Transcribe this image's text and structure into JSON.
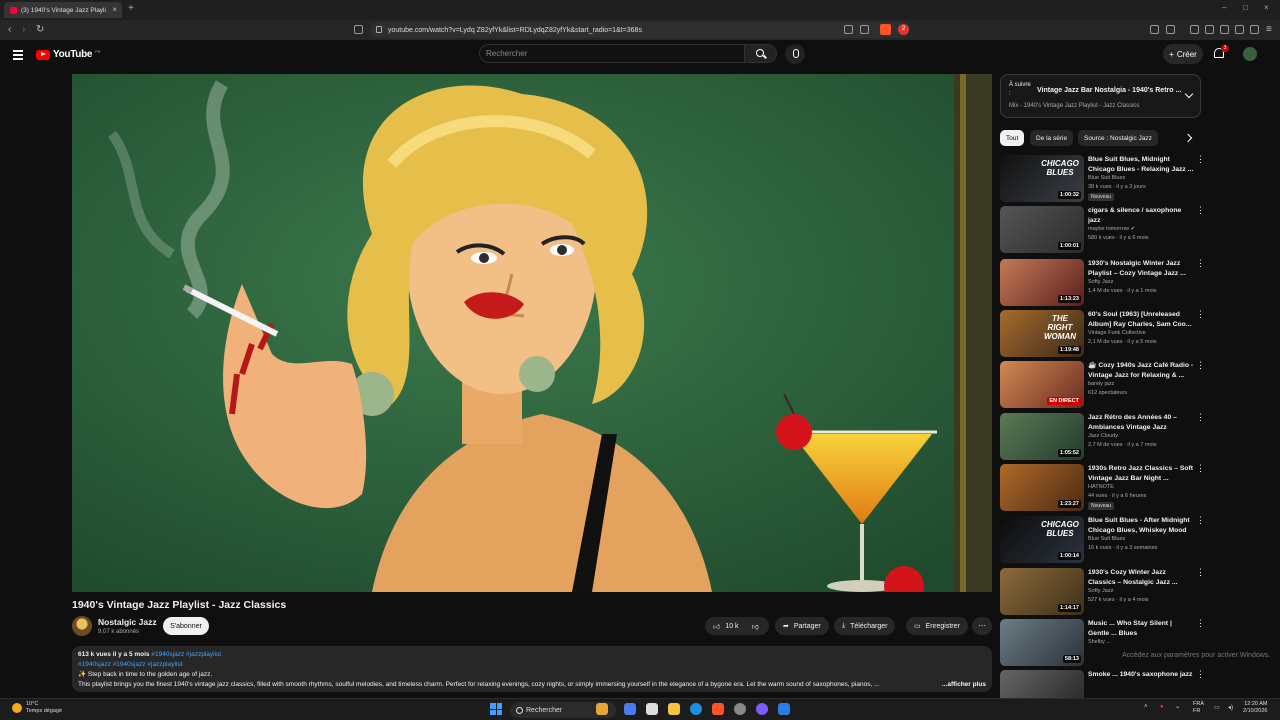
{
  "browser": {
    "tab_title": "(3) 1940's Vintage Jazz Playli",
    "url": "youtube.com/watch?v=Lydq Z82yfYk&list=RDLydqZ82yfYk&start_radio=1&t=368s",
    "ext_badge": "2"
  },
  "header": {
    "logo_text": "YouTube",
    "logo_country": "FR",
    "search_placeholder": "Rechercher",
    "create_label": "Créer",
    "notification_count": "3"
  },
  "video": {
    "title": "1940's Vintage Jazz Playlist - Jazz Classics",
    "channel_name": "Nostalgic Jazz",
    "channel_subs": "9,07 k abonnés",
    "subscribe_label": "S'abonner",
    "like_count": "10 k",
    "share_label": "Partager",
    "download_label": "Télécharger",
    "save_label": "Enregistrer"
  },
  "description": {
    "stats": "613 k vues  il y a 5 mois",
    "tags_line1": "#1940sjazz #jazzplaylist",
    "tags_line2": "#1940sjazz #1940sjazz #jazzplaylist",
    "line3": "✨ Step back in time to the golden age of jazz.",
    "line4": "This playlist brings you the finest 1940's vintage jazz classics, filled with smooth rhythms, soulful melodies, and timeless charm. Perfect for relaxing evenings, cozy nights, or simply immersing yourself in the elegance of a bygone era. Let the warm sound of saxophones, pianos, ...",
    "more_label": "...afficher plus"
  },
  "mix": {
    "label": "À suivre :",
    "title": "Vintage Jazz Bar Nostalgia - 1940's Retro ...",
    "subtitle": "Mix - 1940's Vintage Jazz Playlist - Jazz Classics"
  },
  "chips": [
    "Tout",
    "De la série",
    "Source : Nostalgic Jazz"
  ],
  "recommendations": [
    {
      "title": "Blue Suit Blues, Midnight Chicago Blues - Relaxing Jazz ...",
      "channel": "Blue Suit Blues",
      "meta": "38 k vues · il y a 3 jours",
      "duration": "1:00:32",
      "badge": "Nouveau",
      "thumb_text": "CHICAGO BLUES"
    },
    {
      "title": "cigars & silence / saxophone jazz",
      "channel": "maybe tomorrow ✔",
      "meta": "580 k vues · il y a 6 mois",
      "duration": "1:00:01",
      "badge": "",
      "thumb_text": ""
    },
    {
      "title": "1930's Nostalgic Winter Jazz Playlist – Cozy Vintage Jazz ...",
      "channel": "Softy Jazz",
      "meta": "1,4 M de vues · il y a 1 mois",
      "duration": "1:13:23",
      "badge": "",
      "thumb_text": ""
    },
    {
      "title": "60's Soul (1963) [Unreleased Album] Ray Charles, Sam Coo...",
      "channel": "Vintage Funk Collective",
      "meta": "2,1 M de vues · il y a 5 mois",
      "duration": "1:19:48",
      "badge": "",
      "thumb_text": "THE RIGHT WOMAN"
    },
    {
      "title": "☕ Cozy 1940s Jazz Café Radio - Vintage Jazz for Relaxing & ...",
      "channel": "barely jazz",
      "meta": "612 spectateurs",
      "duration": "EN DIRECT",
      "badge": "",
      "thumb_text": ""
    },
    {
      "title": "Jazz Rétro des Années 40 – Ambiances Vintage Jazz",
      "channel": "Jazz Cloudy",
      "meta": "2,7 M de vues · il y a 7 mois",
      "duration": "1:05:52",
      "badge": "",
      "thumb_text": ""
    },
    {
      "title": "1930s Retro Jazz Classics – Soft Vintage Jazz Bar Night ...",
      "channel": "HATNOTE",
      "meta": "44 vues · il y a 6 heures",
      "duration": "1:23:27",
      "badge": "Nouveau",
      "thumb_text": ""
    },
    {
      "title": "Blue Suit Blues - After Midnight Chicago Blues, Whiskey Mood",
      "channel": "Blue Suit Blues",
      "meta": "16 k vues · il y a 3 semaines",
      "duration": "1:00:14",
      "badge": "",
      "thumb_text": "CHICAGO BLUES"
    },
    {
      "title": "1930's Cozy Winter Jazz Classics – Nostalgic Jazz ...",
      "channel": "Softy Jazz",
      "meta": "527 k vues · il y a 4 mois",
      "duration": "1:14:17",
      "badge": "",
      "thumb_text": ""
    },
    {
      "title": "Music ... Who Stay Silent | Gentle ... Blues",
      "channel": "Shelby ...",
      "meta": "",
      "duration": "58:13",
      "badge": "",
      "thumb_text": ""
    },
    {
      "title": "Smoke ... 1940's saxophone jazz",
      "channel": "",
      "meta": "",
      "duration": "",
      "badge": "",
      "thumb_text": ""
    }
  ],
  "watermark": "Accédez aux paramètres pour activer Windows.",
  "taskbar": {
    "temp": "10°C",
    "weather": "Temps dégagé",
    "search_label": "Rechercher",
    "lang1": "FRA",
    "lang2": "FR",
    "time": "12:20 AM",
    "date": "2/10/2026"
  },
  "colors": {
    "accent_red": "#ff0000",
    "link_blue": "#3ea6ff",
    "bg": "#0f0f0f"
  }
}
